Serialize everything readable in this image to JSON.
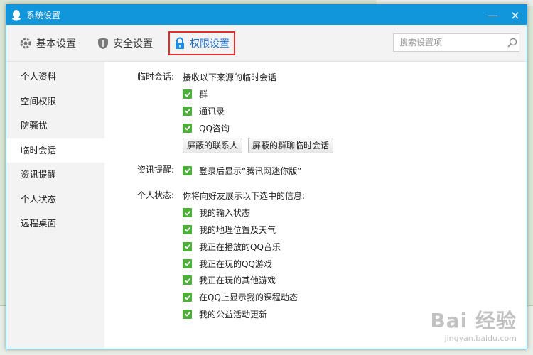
{
  "window": {
    "title": "系统设置",
    "close_label": "×",
    "minimize_label": "—"
  },
  "toolbar": {
    "tabs": [
      {
        "label": "基本设置",
        "icon": "gear-icon"
      },
      {
        "label": "安全设置",
        "icon": "shield-icon"
      },
      {
        "label": "权限设置",
        "icon": "lock-icon",
        "active": true
      }
    ],
    "search_placeholder": "搜索设置项"
  },
  "sidebar": {
    "items": [
      {
        "label": "个人资料"
      },
      {
        "label": "空间权限"
      },
      {
        "label": "防骚扰"
      },
      {
        "label": "临时会话",
        "active": true
      },
      {
        "label": "资讯提醒"
      },
      {
        "label": "个人状态"
      },
      {
        "label": "远程桌面"
      }
    ]
  },
  "sections": {
    "temp_chat": {
      "label": "临时会话:",
      "intro": "接收以下来源的临时会话",
      "options": [
        "群",
        "通讯录",
        "QQ咨询"
      ],
      "buttons": [
        "屏蔽的联系人",
        "屏蔽的群聊临时会话"
      ]
    },
    "news": {
      "label": "资讯提醒:",
      "option": "登录后显示“腾讯网迷你版”"
    },
    "status": {
      "label": "个人状态:",
      "intro": "你将向好友展示以下选中的信息:",
      "options": [
        "我的输入状态",
        "我的地理位置及天气",
        "我正在播放的QQ音乐",
        "我正在玩的QQ游戏",
        "我正在玩的其他游戏",
        "在QQ上显示我的课程动态",
        "我的公益活动更新"
      ]
    }
  },
  "watermark": {
    "main": "Bai 经验",
    "sub": "jingyan.baidu.com"
  },
  "colors": {
    "titlebar": "#1296db",
    "checkbox": "#4caf3a",
    "highlight_border": "#e52b2b",
    "active_tab_text": "#1e6fc8"
  }
}
